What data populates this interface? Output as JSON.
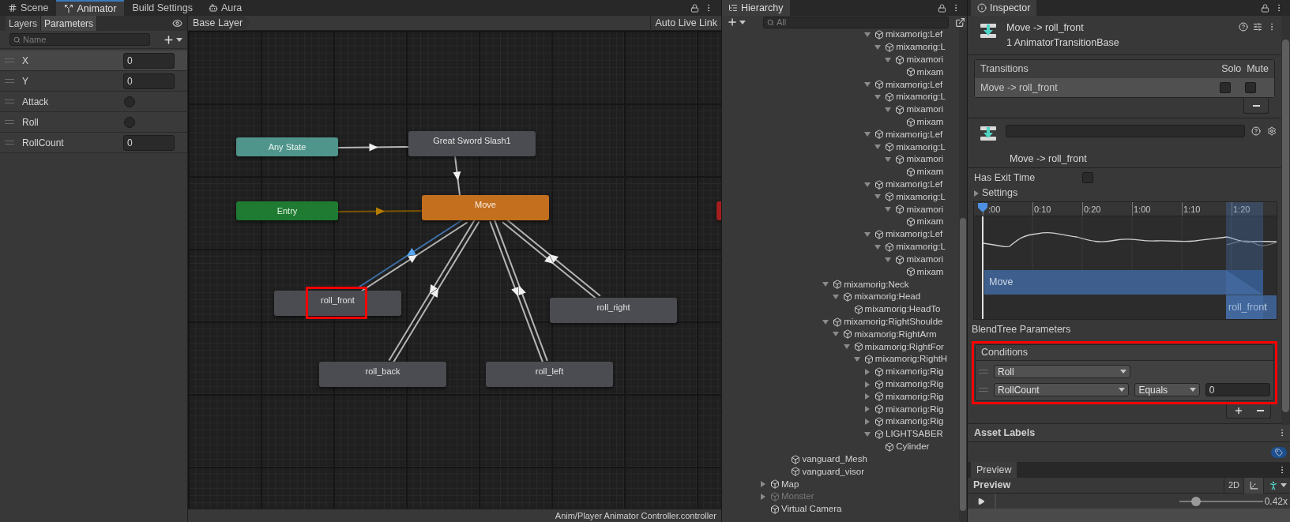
{
  "editor_tabs": [
    {
      "label": "Scene",
      "selected": false
    },
    {
      "label": "Animator",
      "selected": true
    },
    {
      "label": "Build Settings",
      "selected": false
    },
    {
      "label": "Aura",
      "selected": false
    }
  ],
  "animator": {
    "panel_tabs": [
      {
        "label": "Layers",
        "selected": false
      },
      {
        "label": "Parameters",
        "selected": true
      }
    ],
    "search": {
      "placeholder": "Name"
    },
    "parameters": [
      {
        "name": "X",
        "kind": "float",
        "value": "0",
        "selected": true
      },
      {
        "name": "Y",
        "kind": "float",
        "value": "0",
        "selected": false
      },
      {
        "name": "Attack",
        "kind": "bool",
        "checked": false,
        "selected": false
      },
      {
        "name": "Roll",
        "kind": "bool",
        "checked": false,
        "selected": false
      },
      {
        "name": "RollCount",
        "kind": "int",
        "value": "0",
        "selected": false
      }
    ],
    "breadcrumb": "Base Layer",
    "live_link_button": "Auto Live Link",
    "nodes": [
      {
        "label": "Any State",
        "kind": "any",
        "highlighted": false
      },
      {
        "label": "Great Sword Slash1",
        "kind": "state",
        "highlighted": false
      },
      {
        "label": "Entry",
        "kind": "entry",
        "highlighted": false
      },
      {
        "label": "Move",
        "kind": "default",
        "highlighted": false
      },
      {
        "label": "roll_front",
        "kind": "state",
        "highlighted": true
      },
      {
        "label": "roll_right",
        "kind": "state",
        "highlighted": false
      },
      {
        "label": "roll_back",
        "kind": "state",
        "highlighted": false
      },
      {
        "label": "roll_left",
        "kind": "state",
        "highlighted": false
      },
      {
        "kind": "exit"
      }
    ],
    "transitions": [
      {
        "selected": false
      },
      {
        "selected": false
      },
      {
        "selected": false
      },
      {
        "selected": true
      },
      {
        "selected": false
      },
      {
        "selected": false
      },
      {
        "selected": false
      },
      {
        "selected": false
      },
      {
        "selected": false
      },
      {
        "selected": false
      },
      {
        "selected": false
      }
    ],
    "status_path": "Anim/Player Animator Controller.controller"
  },
  "hierarchy": {
    "title": "Hierarchy",
    "search": {
      "placeholder": "All"
    },
    "items": [
      {
        "children": [
          {
            "children": [
              {
                "children": [
                  {
                    "children": [
                      {
                        "children": [
                          {
                            "children": [
                              {
                                "children": [
                                  {
                                    "children": [
                                      {
                                        "children": [
                                          {
                                            "children": [
                                              {
                                                "label": "mixamorig:Lef",
                                                "expanded": true,
                                                "disabled": false,
                                                "children": [
                                                  {
                                                    "label": "mixamorig:L",
                                                    "expanded": true,
                                                    "disabled": false,
                                                    "children": [
                                                      {
                                                        "label": "mixamori",
                                                        "expanded": true,
                                                        "disabled": false,
                                                        "children": [
                                                          {
                                                            "label": "mixam",
                                                            "disabled": false
                                                          }
                                                        ]
                                                      }
                                                    ]
                                                  }
                                                ]
                                              },
                                              {
                                                "label": "mixamorig:Lef",
                                                "expanded": true,
                                                "disabled": false,
                                                "children": [
                                                  {
                                                    "label": "mixamorig:L",
                                                    "expanded": true,
                                                    "disabled": false,
                                                    "children": [
                                                      {
                                                        "label": "mixamori",
                                                        "expanded": true,
                                                        "disabled": false,
                                                        "children": [
                                                          {
                                                            "label": "mixam",
                                                            "disabled": false
                                                          }
                                                        ]
                                                      }
                                                    ]
                                                  }
                                                ]
                                              },
                                              {
                                                "label": "mixamorig:Lef",
                                                "expanded": true,
                                                "disabled": false,
                                                "children": [
                                                  {
                                                    "label": "mixamorig:L",
                                                    "expanded": true,
                                                    "disabled": false,
                                                    "children": [
                                                      {
                                                        "label": "mixamori",
                                                        "expanded": true,
                                                        "disabled": false,
                                                        "children": [
                                                          {
                                                            "label": "mixam",
                                                            "disabled": false
                                                          }
                                                        ]
                                                      }
                                                    ]
                                                  }
                                                ]
                                              },
                                              {
                                                "label": "mixamorig:Lef",
                                                "expanded": true,
                                                "disabled": false,
                                                "children": [
                                                  {
                                                    "label": "mixamorig:L",
                                                    "expanded": true,
                                                    "disabled": false,
                                                    "children": [
                                                      {
                                                        "label": "mixamori",
                                                        "expanded": true,
                                                        "disabled": false,
                                                        "children": [
                                                          {
                                                            "label": "mixam",
                                                            "disabled": false
                                                          }
                                                        ]
                                                      }
                                                    ]
                                                  }
                                                ]
                                              },
                                              {
                                                "label": "mixamorig:Lef",
                                                "expanded": true,
                                                "disabled": false,
                                                "children": [
                                                  {
                                                    "label": "mixamorig:L",
                                                    "expanded": true,
                                                    "disabled": false,
                                                    "children": [
                                                      {
                                                        "label": "mixamori",
                                                        "expanded": true,
                                                        "disabled": false,
                                                        "children": [
                                                          {
                                                            "label": "mixam",
                                                            "disabled": false
                                                          }
                                                        ]
                                                      }
                                                    ]
                                                  }
                                                ]
                                              }
                                            ]
                                          }
                                        ]
                                      }
                                    ]
                                  }
                                ]
                              },
                              {
                                "label": "mixamorig:Neck",
                                "expanded": true,
                                "disabled": false,
                                "children": [
                                  {
                                    "label": "mixamorig:Head",
                                    "expanded": true,
                                    "disabled": false,
                                    "children": [
                                      {
                                        "label": "mixamorig:HeadTo",
                                        "disabled": false
                                      }
                                    ]
                                  }
                                ]
                              },
                              {
                                "label": "mixamorig:RightShoulde",
                                "expanded": true,
                                "disabled": false,
                                "children": [
                                  {
                                    "label": "mixamorig:RightArm",
                                    "expanded": true,
                                    "disabled": false,
                                    "children": [
                                      {
                                        "label": "mixamorig:RightFor",
                                        "expanded": true,
                                        "disabled": false,
                                        "children": [
                                          {
                                            "label": "mixamorig:RightH",
                                            "expanded": true,
                                            "disabled": false,
                                            "children": [
                                              {
                                                "label": "mixamorig:Rig",
                                                "expanded": false,
                                                "disabled": false
                                              },
                                              {
                                                "label": "mixamorig:Rig",
                                                "expanded": false,
                                                "disabled": false
                                              },
                                              {
                                                "label": "mixamorig:Rig",
                                                "expanded": false,
                                                "disabled": false
                                              },
                                              {
                                                "label": "mixamorig:Rig",
                                                "expanded": false,
                                                "disabled": false
                                              },
                                              {
                                                "label": "mixamorig:Rig",
                                                "expanded": false,
                                                "disabled": false
                                              },
                                              {
                                                "label": "LIGHTSABER",
                                                "expanded": true,
                                                "disabled": false,
                                                "children": [
                                                  {
                                                    "label": "Cylinder",
                                                    "disabled": false
                                                  }
                                                ]
                                              }
                                            ]
                                          }
                                        ]
                                      }
                                    ]
                                  }
                                ]
                              }
                            ]
                          }
                        ]
                      }
                    ]
                  }
                ]
              },
              {
                "label": "vanguard_Mesh",
                "disabled": false
              },
              {
                "label": "vanguard_visor",
                "disabled": false
              }
            ]
          }
        ]
      },
      {
        "label": "Map",
        "expanded": false,
        "disabled": false
      },
      {
        "label": "Monster",
        "expanded": false,
        "disabled": true
      },
      {
        "label": "Virtual Camera",
        "disabled": false
      }
    ]
  },
  "inspector": {
    "title": "Inspector",
    "header": {
      "title": "Move -> roll_front",
      "subtitle": "1 AnimatorTransitionBase"
    },
    "transition_list": {
      "columns": [
        "Transitions",
        "Solo",
        "Mute"
      ],
      "rows": [
        {
          "name": "Move -> roll_front",
          "solo": false,
          "mute": false,
          "selected": true
        }
      ]
    },
    "transition_label": "Move -> roll_front",
    "has_exit_time": {
      "label": "Has Exit Time",
      "checked": false
    },
    "settings": {
      "label": "Settings",
      "expanded": false
    },
    "timeline": {
      "ticks": [
        ":00",
        "0:10",
        "0:20",
        "1:00",
        "1:10",
        "1:20"
      ],
      "source": "Move",
      "target": "roll_front"
    },
    "blend_tree_label": "BlendTree Parameters",
    "conditions": {
      "title": "Conditions",
      "highlighted": true,
      "rows": [
        {
          "parameter": "Roll"
        },
        {
          "parameter": "RollCount",
          "mode": "Equals",
          "value": "0"
        }
      ]
    },
    "asset_labels": "Asset Labels",
    "preview": {
      "tab": "Preview",
      "title": "Preview",
      "mode_button": "2D",
      "speed": {
        "level": 0.2,
        "reading": "0.42x"
      }
    }
  }
}
